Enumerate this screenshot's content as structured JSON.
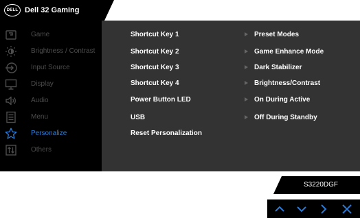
{
  "header": {
    "title": "Dell 32 Gaming Monitor",
    "logo_text": "DELL"
  },
  "sidebar": {
    "items": [
      {
        "label": "Game",
        "icon": "game-icon"
      },
      {
        "label": "Brightness / Contrast",
        "icon": "brightness-icon"
      },
      {
        "label": "Input Source",
        "icon": "input-source-icon"
      },
      {
        "label": "Display",
        "icon": "display-icon"
      },
      {
        "label": "Audio",
        "icon": "audio-icon"
      },
      {
        "label": "Menu",
        "icon": "menu-icon"
      },
      {
        "label": "Personalize",
        "icon": "star-icon",
        "active": true
      },
      {
        "label": "Others",
        "icon": "others-icon"
      }
    ]
  },
  "content": {
    "rows": [
      {
        "label": "Shortcut Key 1",
        "value": "Preset Modes"
      },
      {
        "label": "Shortcut Key 2",
        "value": "Game Enhance Mode"
      },
      {
        "label": "Shortcut Key 3",
        "value": "Dark Stabilizer"
      },
      {
        "label": "Shortcut Key 4",
        "value": "Brightness/Contrast"
      },
      {
        "label": "Power Button LED",
        "value": "On During Active"
      },
      {
        "label": "USB",
        "value": "Off During Standby"
      },
      {
        "label": "Reset Personalization",
        "value": ""
      }
    ]
  },
  "model": "S3220DGF",
  "controls": [
    {
      "icon": "up-arrow-icon"
    },
    {
      "icon": "down-arrow-icon"
    },
    {
      "icon": "right-arrow-icon"
    },
    {
      "icon": "close-icon"
    }
  ],
  "colors": {
    "accent": "#2a7bd4",
    "inactive_text": "#4d4d4d",
    "content_bg": "#333333"
  }
}
